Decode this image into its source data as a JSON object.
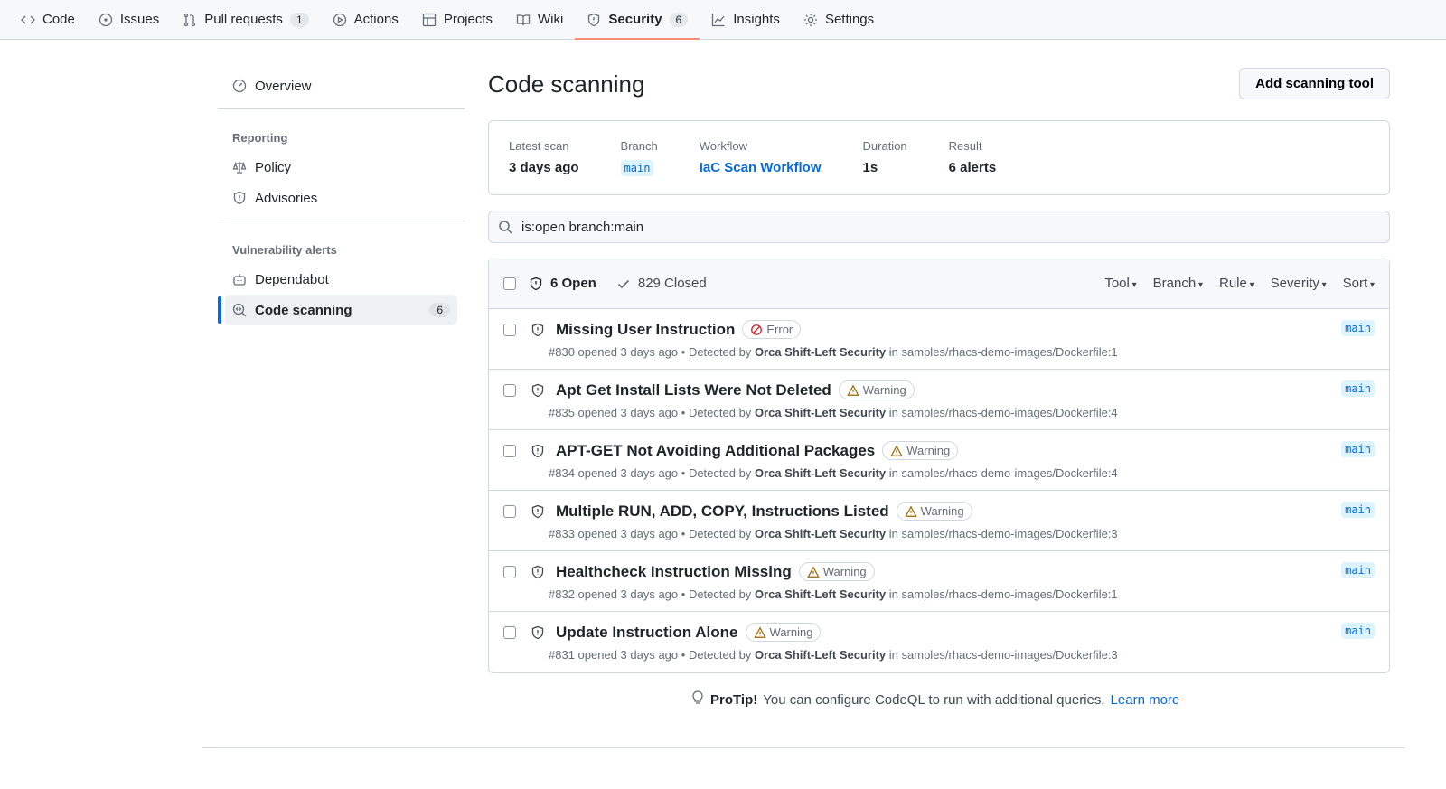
{
  "nav": [
    {
      "label": "Code",
      "icon": "code-icon"
    },
    {
      "label": "Issues",
      "icon": "issue-icon"
    },
    {
      "label": "Pull requests",
      "icon": "pull-request-icon",
      "count": "1"
    },
    {
      "label": "Actions",
      "icon": "play-icon"
    },
    {
      "label": "Projects",
      "icon": "table-icon"
    },
    {
      "label": "Wiki",
      "icon": "book-icon"
    },
    {
      "label": "Security",
      "icon": "shield-icon",
      "count": "6",
      "active": true
    },
    {
      "label": "Insights",
      "icon": "graph-icon"
    },
    {
      "label": "Settings",
      "icon": "gear-icon"
    }
  ],
  "sidebar": {
    "overview": "Overview",
    "reporting": "Reporting",
    "policy": "Policy",
    "advisories": "Advisories",
    "vuln": "Vulnerability alerts",
    "dependabot": "Dependabot",
    "code_scanning": "Code scanning",
    "code_scanning_count": "6"
  },
  "main": {
    "title": "Code scanning",
    "add_button": "Add scanning tool",
    "scan": {
      "latest_label": "Latest scan",
      "latest": "3 days ago",
      "branch_label": "Branch",
      "branch": "main",
      "workflow_label": "Workflow",
      "workflow": "IaC Scan Workflow",
      "duration_label": "Duration",
      "duration": "1s",
      "result_label": "Result",
      "result": "6 alerts"
    },
    "search": "is:open branch:main",
    "open": "6 Open",
    "closed": "829 Closed",
    "filters": [
      "Tool",
      "Branch",
      "Rule",
      "Severity",
      "Sort"
    ],
    "alerts": [
      {
        "title": "Missing User Instruction",
        "severity": "Error",
        "num": "#830",
        "opened": "opened 3 days ago",
        "detected": "Detected by",
        "tool": "Orca Shift-Left Security",
        "in": "in",
        "path": "samples/rhacs-demo-images/Dockerfile:1",
        "branch": "main"
      },
      {
        "title": "Apt Get Install Lists Were Not Deleted",
        "severity": "Warning",
        "num": "#835",
        "opened": "opened 3 days ago",
        "detected": "Detected by",
        "tool": "Orca Shift-Left Security",
        "in": "in",
        "path": "samples/rhacs-demo-images/Dockerfile:4",
        "branch": "main"
      },
      {
        "title": "APT-GET Not Avoiding Additional Packages",
        "severity": "Warning",
        "num": "#834",
        "opened": "opened 3 days ago",
        "detected": "Detected by",
        "tool": "Orca Shift-Left Security",
        "in": "in",
        "path": "samples/rhacs-demo-images/Dockerfile:4",
        "branch": "main"
      },
      {
        "title": "Multiple RUN, ADD, COPY, Instructions Listed",
        "severity": "Warning",
        "num": "#833",
        "opened": "opened 3 days ago",
        "detected": "Detected by",
        "tool": "Orca Shift-Left Security",
        "in": "in",
        "path": "samples/rhacs-demo-images/Dockerfile:3",
        "branch": "main"
      },
      {
        "title": "Healthcheck Instruction Missing",
        "severity": "Warning",
        "num": "#832",
        "opened": "opened 3 days ago",
        "detected": "Detected by",
        "tool": "Orca Shift-Left Security",
        "in": "in",
        "path": "samples/rhacs-demo-images/Dockerfile:1",
        "branch": "main"
      },
      {
        "title": "Update Instruction Alone",
        "severity": "Warning",
        "num": "#831",
        "opened": "opened 3 days ago",
        "detected": "Detected by",
        "tool": "Orca Shift-Left Security",
        "in": "in",
        "path": "samples/rhacs-demo-images/Dockerfile:3",
        "branch": "main"
      }
    ],
    "protip_label": "ProTip!",
    "protip": "You can configure CodeQL to run with additional queries.",
    "learn_more": "Learn more"
  },
  "colors": {
    "accent": "#0969da",
    "error": "#cf222e",
    "warning": "#9a6700",
    "underline": "#fd8c73"
  }
}
